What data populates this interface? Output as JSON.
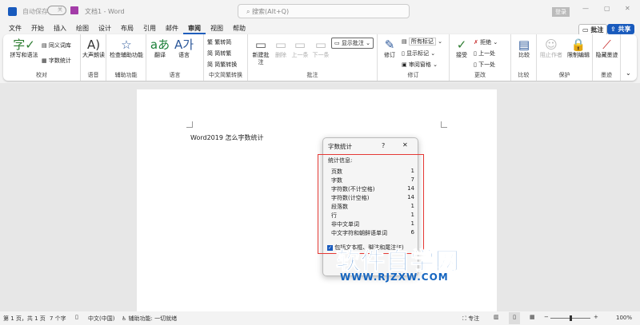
{
  "titlebar": {
    "autosave": "自动保存",
    "autosave_state": "关",
    "doc_title": "文档1 - Word",
    "search_placeholder": "搜索(Alt+Q)",
    "login": "登录"
  },
  "tabs": [
    "文件",
    "开始",
    "插入",
    "绘图",
    "设计",
    "布局",
    "引用",
    "邮件",
    "审阅",
    "视图",
    "帮助"
  ],
  "active_tab": "审阅",
  "actions": {
    "comment": "批注",
    "share": "共享"
  },
  "ribbon": {
    "proofing": {
      "spell": "拼写和语法",
      "thesaurus": "同义词库",
      "wordcount": "字数统计",
      "label": "校对"
    },
    "speech": {
      "read": "大声朗读",
      "label": "语音"
    },
    "access": {
      "check": "检查辅助功能",
      "label": "辅助功能"
    },
    "language": {
      "translate": "翻译",
      "lang": "语言",
      "label": "语言"
    },
    "chinese": {
      "t2s": "繁转简",
      "s2t": "简转繁",
      "convert": "简繁转换",
      "label": "中文简繁转换"
    },
    "comments": {
      "new": "新建批注",
      "delete": "删除",
      "prev": "上一条",
      "next": "下一条",
      "show": "显示批注",
      "label": "批注"
    },
    "tracking": {
      "track": "修订",
      "all_markup": "所有标记",
      "show_markup": "显示标记",
      "pane": "审阅窗格",
      "label": "修订"
    },
    "changes": {
      "accept": "接受",
      "reject": "拒绝",
      "prev": "上一处",
      "next": "下一处",
      "label": "更改"
    },
    "compare": {
      "compare": "比较",
      "label": "比较"
    },
    "protect": {
      "block": "阻止作者",
      "restrict": "限制编辑",
      "label": "保护"
    },
    "ink": {
      "hide": "隐藏墨迹",
      "label": "墨迹"
    }
  },
  "document": {
    "text": "Word2019 怎么字数统计"
  },
  "dialog": {
    "title": "字数统计",
    "help": "?",
    "stats_label": "统计信息:",
    "rows": [
      {
        "k": "页数",
        "v": "1"
      },
      {
        "k": "字数",
        "v": "7"
      },
      {
        "k": "字符数(不计空格)",
        "v": "14"
      },
      {
        "k": "字符数(计空格)",
        "v": "14"
      },
      {
        "k": "段落数",
        "v": "1"
      },
      {
        "k": "行",
        "v": "1"
      },
      {
        "k": "非中文单词",
        "v": "1"
      },
      {
        "k": "中文字符和朝鲜语单词",
        "v": "6"
      }
    ],
    "checkbox": "包括文本框、脚注和尾注(F)"
  },
  "watermark": {
    "title": "软件自学网",
    "url": "WWW.RJZXW.COM"
  },
  "status": {
    "page": "第 1 页，共 1 页",
    "words": "7 个字",
    "lang": "中文(中国)",
    "access": "辅助功能: 一切就绪",
    "focus": "专注",
    "zoom": "100%"
  },
  "zoom_percent": 100,
  "colors": {
    "accent": "#185abd",
    "red": "#e53935",
    "watermark": "#1565c0"
  }
}
